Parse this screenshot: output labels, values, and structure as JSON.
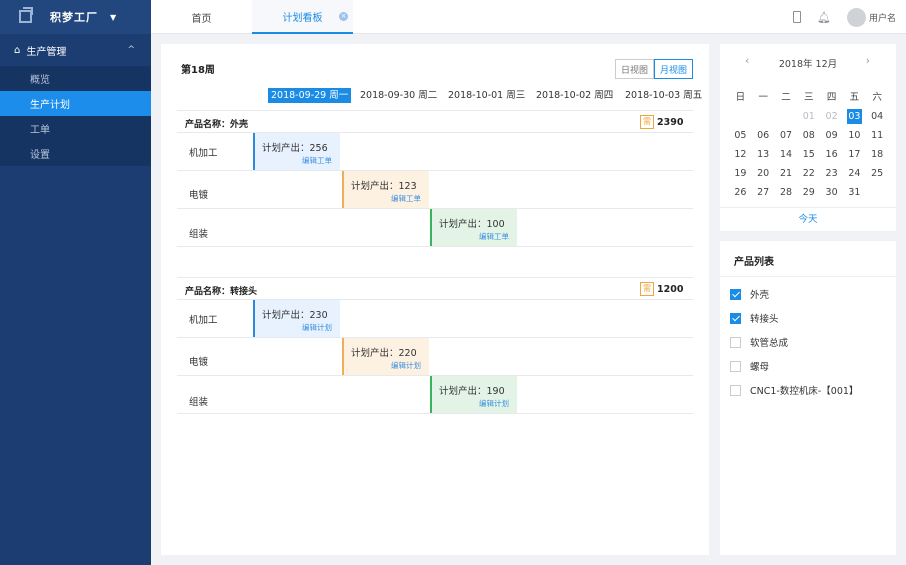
{
  "brand": {
    "name": "积梦工厂"
  },
  "sidebar": {
    "group_label": "生产管理",
    "items": [
      {
        "label": "概览"
      },
      {
        "label": "生产计划"
      },
      {
        "label": "工单"
      },
      {
        "label": "设置"
      }
    ]
  },
  "tabs": [
    {
      "label": "首页"
    },
    {
      "label": "计划看板"
    }
  ],
  "user": {
    "name": "用户名"
  },
  "board": {
    "week": "第18周",
    "views": {
      "day": "日视图",
      "month": "月视图",
      "active": "月视图"
    },
    "dates": [
      "2018-09-29 周一",
      "2018-09-30 周二",
      "2018-10-01 周三",
      "2018-10-02 周四",
      "2018-10-03 周五"
    ],
    "products": [
      {
        "title": "产品名称：外壳",
        "total_icon": "需",
        "total": "2390",
        "rows": [
          {
            "process": "机加工",
            "plan_text": "计划产出：256",
            "edit": "编辑工单"
          },
          {
            "process": "电镀",
            "plan_text": "计划产出：123",
            "edit": "编辑工单"
          },
          {
            "process": "组装",
            "plan_text": "计划产出：100",
            "edit": "编辑工单"
          }
        ]
      },
      {
        "title": "产品名称：转接头",
        "total_icon": "需",
        "total": "1200",
        "rows": [
          {
            "process": "机加工",
            "plan_text": "计划产出：230",
            "edit": "编辑计划"
          },
          {
            "process": "电镀",
            "plan_text": "计划产出：220",
            "edit": "编辑计划"
          },
          {
            "process": "组装",
            "plan_text": "计划产出：190",
            "edit": "编辑计划"
          }
        ]
      }
    ]
  },
  "calendar": {
    "title": "2018年 12月",
    "weekdays": [
      "日",
      "一",
      "二",
      "三",
      "四",
      "五",
      "六"
    ],
    "weeks": [
      [
        "",
        "",
        "",
        "01",
        "02",
        "03",
        "04"
      ],
      [
        "05",
        "06",
        "07",
        "08",
        "09",
        "10",
        "11"
      ],
      [
        "12",
        "13",
        "14",
        "15",
        "16",
        "17",
        "18"
      ],
      [
        "19",
        "20",
        "21",
        "22",
        "23",
        "24",
        "25"
      ],
      [
        "26",
        "27",
        "28",
        "29",
        "30",
        "31",
        ""
      ]
    ],
    "selected": "03",
    "dim": [
      "01",
      "02"
    ],
    "today_label": "今天"
  },
  "product_list": {
    "title": "产品列表",
    "items": [
      {
        "label": "外壳",
        "checked": true
      },
      {
        "label": "转接头",
        "checked": true
      },
      {
        "label": "软管总成",
        "checked": false
      },
      {
        "label": "螺母",
        "checked": false
      },
      {
        "label": "CNC1-数控机床-【001】",
        "checked": false
      }
    ]
  },
  "colors": {
    "accent": "#1a8ce6",
    "sidebar": "#1c3d72",
    "active_item": "#1c8dea"
  }
}
